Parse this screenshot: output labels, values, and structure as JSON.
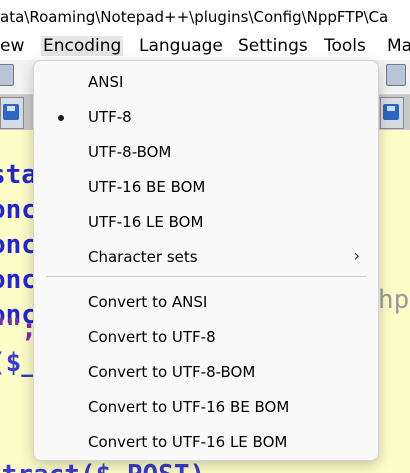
{
  "window": {
    "title": "ata\\Roaming\\Notepad++\\plugins\\Config\\NppFTP\\Ca"
  },
  "menubar": {
    "items": [
      {
        "label": "ew"
      },
      {
        "label": "Encoding"
      },
      {
        "label": "Language"
      },
      {
        "label": "Settings"
      },
      {
        "label": "Tools"
      },
      {
        "label": "Ma"
      }
    ]
  },
  "editor": {
    "lines": [
      {
        "t1": "sta",
        "t2": ""
      },
      {
        "t1": "onc",
        "t2": ""
      },
      {
        "t1": "onc",
        "t2": ""
      },
      {
        "t1": "onc",
        "t2": ""
      },
      {
        "t1": "onc",
        "t2": "hp"
      },
      {
        "t1": "\"\";",
        "t2": ""
      },
      {
        "t1": "($_",
        "t2": ""
      },
      {
        "t1": "xtract($_POST)",
        "t2": ""
      }
    ]
  },
  "encoding_menu": {
    "items": [
      {
        "label": "ANSI",
        "selected": false
      },
      {
        "label": "UTF-8",
        "selected": true
      },
      {
        "label": "UTF-8-BOM",
        "selected": false
      },
      {
        "label": "UTF-16 BE BOM",
        "selected": false
      },
      {
        "label": "UTF-16 LE BOM",
        "selected": false
      },
      {
        "label": "Character sets",
        "submenu_icon": "chevron-right-icon"
      }
    ],
    "convert_items": [
      {
        "label": "Convert to ANSI"
      },
      {
        "label": "Convert to UTF-8"
      },
      {
        "label": "Convert to UTF-8-BOM"
      },
      {
        "label": "Convert to UTF-16 BE BOM"
      },
      {
        "label": "Convert to UTF-16 LE BOM"
      }
    ]
  },
  "colors": {
    "editor_bg": "#fdfdc8",
    "keyword": "#2424d4",
    "menu_bg": "#f9f9f9"
  }
}
